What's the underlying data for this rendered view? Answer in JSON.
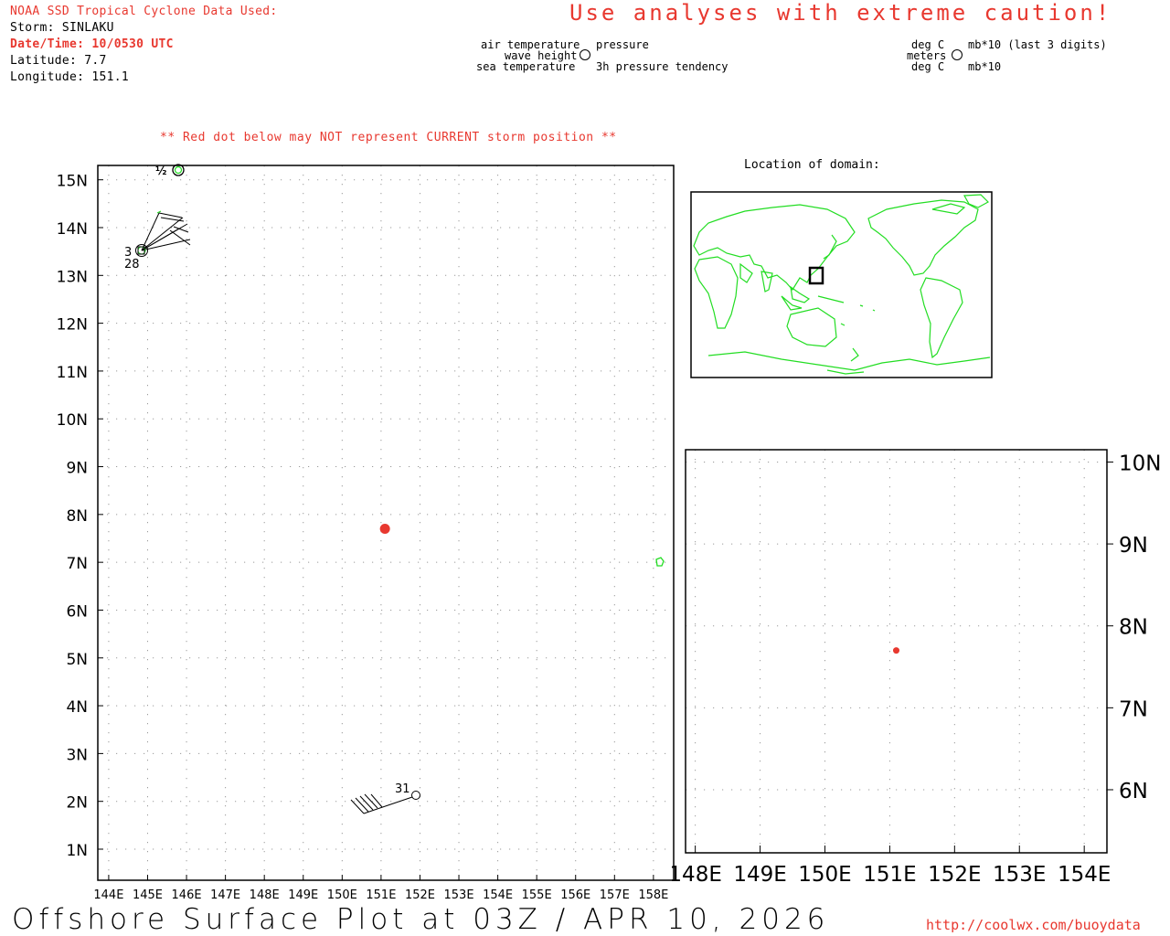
{
  "header": {
    "source": "NOAA SSD Tropical Cyclone Data Used:",
    "storm": "Storm: SINLAKU",
    "datetime": "Date/Time: 10/0530 UTC",
    "latitude": "Latitude: 7.7",
    "longitude": "Longitude: 151.1"
  },
  "caution": "Use analyses with extreme caution!",
  "legend": {
    "air_temperature": "air temperature",
    "wave_height": "wave height",
    "sea_temperature": "sea temperature",
    "pressure": "pressure",
    "pressure_tendency": "3h pressure tendency",
    "unit_deg_c_top": "deg C",
    "unit_meters": "meters",
    "unit_deg_c_bottom": "deg C",
    "unit_mb_last3": "mb*10 (last 3 digits)",
    "unit_mb": "mb*10"
  },
  "red_dot_warning": "** Red dot below may NOT represent CURRENT storm position **",
  "location_of_domain": "Location of domain:",
  "main_map": {
    "lat_labels": [
      "15N",
      "14N",
      "13N",
      "12N",
      "11N",
      "10N",
      "9N",
      "8N",
      "7N",
      "6N",
      "5N",
      "4N",
      "3N",
      "2N",
      "1N"
    ],
    "lon_labels": [
      "144E",
      "145E",
      "146E",
      "147E",
      "148E",
      "149E",
      "150E",
      "151E",
      "152E",
      "153E",
      "154E",
      "155E",
      "156E",
      "157E",
      "158E"
    ],
    "storm_position": {
      "lat": 7.7,
      "lon": 151.1
    },
    "station_labels": {
      "top": "½",
      "left_value": "3",
      "bottom_value": "28",
      "south_value": "31"
    }
  },
  "zoom_map": {
    "lat_labels": [
      "10N",
      "9N",
      "8N",
      "7N",
      "6N"
    ],
    "lon_labels": [
      "148E",
      "149E",
      "150E",
      "151E",
      "152E",
      "153E",
      "154E"
    ],
    "storm_position": {
      "lat": 7.7,
      "lon": 151.1
    }
  },
  "footer": {
    "title": "Offshore Surface Plot at 03Z / APR 10, 2026",
    "url": "http://coolwx.com/buoydata"
  },
  "colors": {
    "accent_red": "#e8382f",
    "coast_green": "#22dd22",
    "storm_red": "#e8382f"
  }
}
